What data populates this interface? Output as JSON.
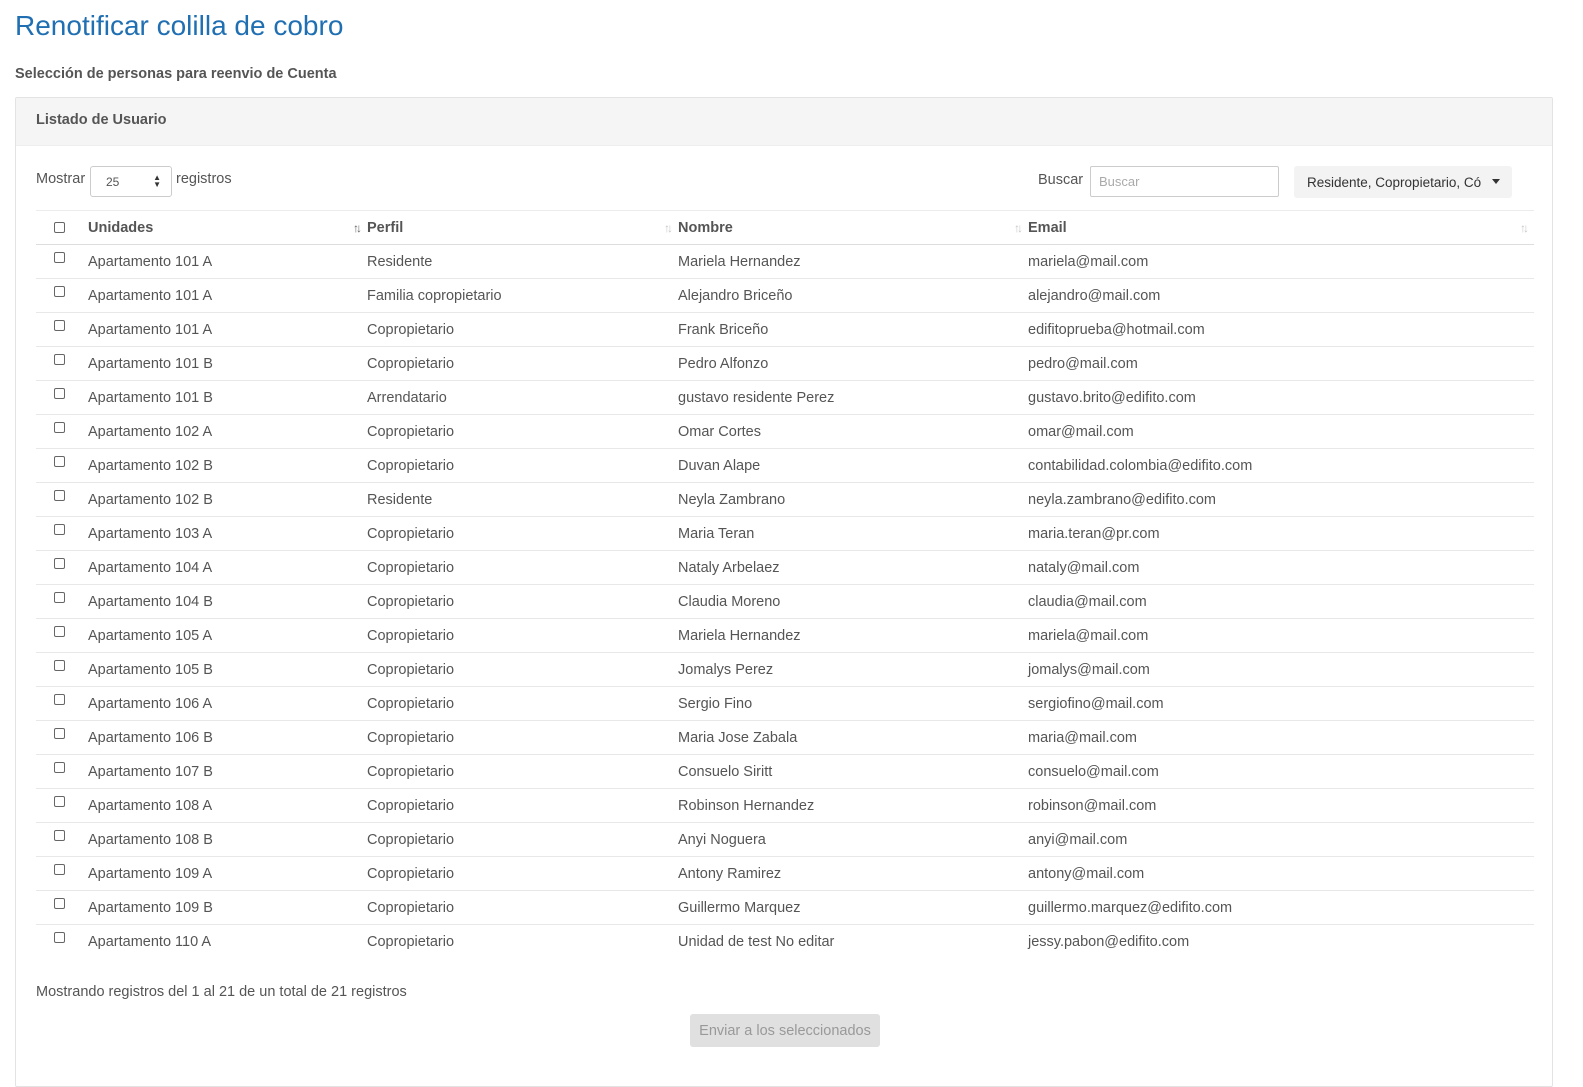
{
  "page": {
    "title": "Renotificar colilla de cobro",
    "subtitle": "Selección de personas para reenvio de Cuenta"
  },
  "panel": {
    "heading": "Listado de Usuario"
  },
  "controls": {
    "length_prefix": "Mostrar",
    "length_value": "25",
    "length_suffix": "registros",
    "search_label": "Buscar",
    "search_placeholder": "Buscar",
    "filter_label": "Residente, Copropietario, Có"
  },
  "table": {
    "columns": [
      "Unidades",
      "Perfil",
      "Nombre",
      "Email"
    ],
    "sorted_column": "Unidades",
    "rows": [
      [
        "Apartamento 101 A",
        "Residente",
        "Mariela Hernandez",
        "mariela@mail.com"
      ],
      [
        "Apartamento 101 A",
        "Familia copropietario",
        "Alejandro Briceño",
        "alejandro@mail.com"
      ],
      [
        "Apartamento 101 A",
        "Copropietario",
        "Frank Briceño",
        "edifitoprueba@hotmail.com"
      ],
      [
        "Apartamento 101 B",
        "Copropietario",
        "Pedro Alfonzo",
        "pedro@mail.com"
      ],
      [
        "Apartamento 101 B",
        "Arrendatario",
        "gustavo residente Perez",
        "gustavo.brito@edifito.com"
      ],
      [
        "Apartamento 102 A",
        "Copropietario",
        "Omar Cortes",
        "omar@mail.com"
      ],
      [
        "Apartamento 102 B",
        "Copropietario",
        "Duvan Alape",
        "contabilidad.colombia@edifito.com"
      ],
      [
        "Apartamento 102 B",
        "Residente",
        "Neyla Zambrano",
        "neyla.zambrano@edifito.com"
      ],
      [
        "Apartamento 103 A",
        "Copropietario",
        "Maria Teran",
        "maria.teran@pr.com"
      ],
      [
        "Apartamento 104 A",
        "Copropietario",
        "Nataly Arbelaez",
        "nataly@mail.com"
      ],
      [
        "Apartamento 104 B",
        "Copropietario",
        "Claudia Moreno",
        "claudia@mail.com"
      ],
      [
        "Apartamento 105 A",
        "Copropietario",
        "Mariela Hernandez",
        "mariela@mail.com"
      ],
      [
        "Apartamento 105 B",
        "Copropietario",
        "Jomalys Perez",
        "jomalys@mail.com"
      ],
      [
        "Apartamento 106 A",
        "Copropietario",
        "Sergio Fino",
        "sergiofino@mail.com"
      ],
      [
        "Apartamento 106 B",
        "Copropietario",
        "Maria Jose Zabala",
        "maria@mail.com"
      ],
      [
        "Apartamento 107 B",
        "Copropietario",
        "Consuelo Siritt",
        "consuelo@mail.com"
      ],
      [
        "Apartamento 108 A",
        "Copropietario",
        "Robinson Hernandez",
        "robinson@mail.com"
      ],
      [
        "Apartamento 108 B",
        "Copropietario",
        "Anyi Noguera",
        "anyi@mail.com"
      ],
      [
        "Apartamento 109 A",
        "Copropietario",
        "Antony Ramirez",
        "antony@mail.com"
      ],
      [
        "Apartamento 109 B",
        "Copropietario",
        "Guillermo Marquez",
        "guillermo.marquez@edifito.com"
      ],
      [
        "Apartamento 110 A",
        "Copropietario",
        "Unidad de test No editar",
        "jessy.pabon@edifito.com"
      ]
    ]
  },
  "footer": {
    "info": "Mostrando registros del 1 al 21 de un total de 21 registros",
    "send_label": "Enviar a los seleccionados"
  },
  "colors": {
    "title": "#1f6fb2",
    "text": "#555555",
    "panel_heading_bg": "#f5f5f5",
    "button_disabled_bg": "#e0e0e0"
  },
  "icons": {
    "sort_active": "sort-ascending-icon",
    "sort_inactive": "sort-both-icon",
    "filter_caret": "caret-down-icon"
  }
}
